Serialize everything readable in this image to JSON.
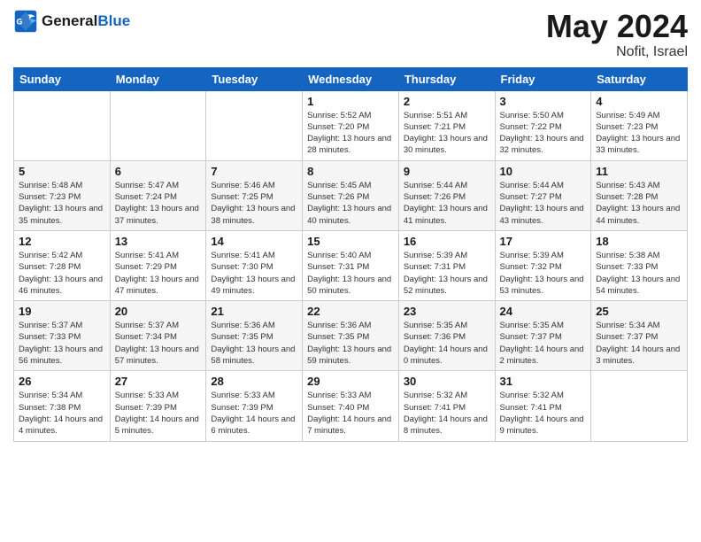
{
  "header": {
    "logo_line1": "General",
    "logo_line2": "Blue",
    "month": "May 2024",
    "location": "Nofit, Israel"
  },
  "weekdays": [
    "Sunday",
    "Monday",
    "Tuesday",
    "Wednesday",
    "Thursday",
    "Friday",
    "Saturday"
  ],
  "weeks": [
    [
      {
        "day": "",
        "sunrise": "",
        "sunset": "",
        "daylight": ""
      },
      {
        "day": "",
        "sunrise": "",
        "sunset": "",
        "daylight": ""
      },
      {
        "day": "",
        "sunrise": "",
        "sunset": "",
        "daylight": ""
      },
      {
        "day": "1",
        "sunrise": "Sunrise: 5:52 AM",
        "sunset": "Sunset: 7:20 PM",
        "daylight": "Daylight: 13 hours and 28 minutes."
      },
      {
        "day": "2",
        "sunrise": "Sunrise: 5:51 AM",
        "sunset": "Sunset: 7:21 PM",
        "daylight": "Daylight: 13 hours and 30 minutes."
      },
      {
        "day": "3",
        "sunrise": "Sunrise: 5:50 AM",
        "sunset": "Sunset: 7:22 PM",
        "daylight": "Daylight: 13 hours and 32 minutes."
      },
      {
        "day": "4",
        "sunrise": "Sunrise: 5:49 AM",
        "sunset": "Sunset: 7:23 PM",
        "daylight": "Daylight: 13 hours and 33 minutes."
      }
    ],
    [
      {
        "day": "5",
        "sunrise": "Sunrise: 5:48 AM",
        "sunset": "Sunset: 7:23 PM",
        "daylight": "Daylight: 13 hours and 35 minutes."
      },
      {
        "day": "6",
        "sunrise": "Sunrise: 5:47 AM",
        "sunset": "Sunset: 7:24 PM",
        "daylight": "Daylight: 13 hours and 37 minutes."
      },
      {
        "day": "7",
        "sunrise": "Sunrise: 5:46 AM",
        "sunset": "Sunset: 7:25 PM",
        "daylight": "Daylight: 13 hours and 38 minutes."
      },
      {
        "day": "8",
        "sunrise": "Sunrise: 5:45 AM",
        "sunset": "Sunset: 7:26 PM",
        "daylight": "Daylight: 13 hours and 40 minutes."
      },
      {
        "day": "9",
        "sunrise": "Sunrise: 5:44 AM",
        "sunset": "Sunset: 7:26 PM",
        "daylight": "Daylight: 13 hours and 41 minutes."
      },
      {
        "day": "10",
        "sunrise": "Sunrise: 5:44 AM",
        "sunset": "Sunset: 7:27 PM",
        "daylight": "Daylight: 13 hours and 43 minutes."
      },
      {
        "day": "11",
        "sunrise": "Sunrise: 5:43 AM",
        "sunset": "Sunset: 7:28 PM",
        "daylight": "Daylight: 13 hours and 44 minutes."
      }
    ],
    [
      {
        "day": "12",
        "sunrise": "Sunrise: 5:42 AM",
        "sunset": "Sunset: 7:28 PM",
        "daylight": "Daylight: 13 hours and 46 minutes."
      },
      {
        "day": "13",
        "sunrise": "Sunrise: 5:41 AM",
        "sunset": "Sunset: 7:29 PM",
        "daylight": "Daylight: 13 hours and 47 minutes."
      },
      {
        "day": "14",
        "sunrise": "Sunrise: 5:41 AM",
        "sunset": "Sunset: 7:30 PM",
        "daylight": "Daylight: 13 hours and 49 minutes."
      },
      {
        "day": "15",
        "sunrise": "Sunrise: 5:40 AM",
        "sunset": "Sunset: 7:31 PM",
        "daylight": "Daylight: 13 hours and 50 minutes."
      },
      {
        "day": "16",
        "sunrise": "Sunrise: 5:39 AM",
        "sunset": "Sunset: 7:31 PM",
        "daylight": "Daylight: 13 hours and 52 minutes."
      },
      {
        "day": "17",
        "sunrise": "Sunrise: 5:39 AM",
        "sunset": "Sunset: 7:32 PM",
        "daylight": "Daylight: 13 hours and 53 minutes."
      },
      {
        "day": "18",
        "sunrise": "Sunrise: 5:38 AM",
        "sunset": "Sunset: 7:33 PM",
        "daylight": "Daylight: 13 hours and 54 minutes."
      }
    ],
    [
      {
        "day": "19",
        "sunrise": "Sunrise: 5:37 AM",
        "sunset": "Sunset: 7:33 PM",
        "daylight": "Daylight: 13 hours and 56 minutes."
      },
      {
        "day": "20",
        "sunrise": "Sunrise: 5:37 AM",
        "sunset": "Sunset: 7:34 PM",
        "daylight": "Daylight: 13 hours and 57 minutes."
      },
      {
        "day": "21",
        "sunrise": "Sunrise: 5:36 AM",
        "sunset": "Sunset: 7:35 PM",
        "daylight": "Daylight: 13 hours and 58 minutes."
      },
      {
        "day": "22",
        "sunrise": "Sunrise: 5:36 AM",
        "sunset": "Sunset: 7:35 PM",
        "daylight": "Daylight: 13 hours and 59 minutes."
      },
      {
        "day": "23",
        "sunrise": "Sunrise: 5:35 AM",
        "sunset": "Sunset: 7:36 PM",
        "daylight": "Daylight: 14 hours and 0 minutes."
      },
      {
        "day": "24",
        "sunrise": "Sunrise: 5:35 AM",
        "sunset": "Sunset: 7:37 PM",
        "daylight": "Daylight: 14 hours and 2 minutes."
      },
      {
        "day": "25",
        "sunrise": "Sunrise: 5:34 AM",
        "sunset": "Sunset: 7:37 PM",
        "daylight": "Daylight: 14 hours and 3 minutes."
      }
    ],
    [
      {
        "day": "26",
        "sunrise": "Sunrise: 5:34 AM",
        "sunset": "Sunset: 7:38 PM",
        "daylight": "Daylight: 14 hours and 4 minutes."
      },
      {
        "day": "27",
        "sunrise": "Sunrise: 5:33 AM",
        "sunset": "Sunset: 7:39 PM",
        "daylight": "Daylight: 14 hours and 5 minutes."
      },
      {
        "day": "28",
        "sunrise": "Sunrise: 5:33 AM",
        "sunset": "Sunset: 7:39 PM",
        "daylight": "Daylight: 14 hours and 6 minutes."
      },
      {
        "day": "29",
        "sunrise": "Sunrise: 5:33 AM",
        "sunset": "Sunset: 7:40 PM",
        "daylight": "Daylight: 14 hours and 7 minutes."
      },
      {
        "day": "30",
        "sunrise": "Sunrise: 5:32 AM",
        "sunset": "Sunset: 7:41 PM",
        "daylight": "Daylight: 14 hours and 8 minutes."
      },
      {
        "day": "31",
        "sunrise": "Sunrise: 5:32 AM",
        "sunset": "Sunset: 7:41 PM",
        "daylight": "Daylight: 14 hours and 9 minutes."
      },
      {
        "day": "",
        "sunrise": "",
        "sunset": "",
        "daylight": ""
      }
    ]
  ]
}
